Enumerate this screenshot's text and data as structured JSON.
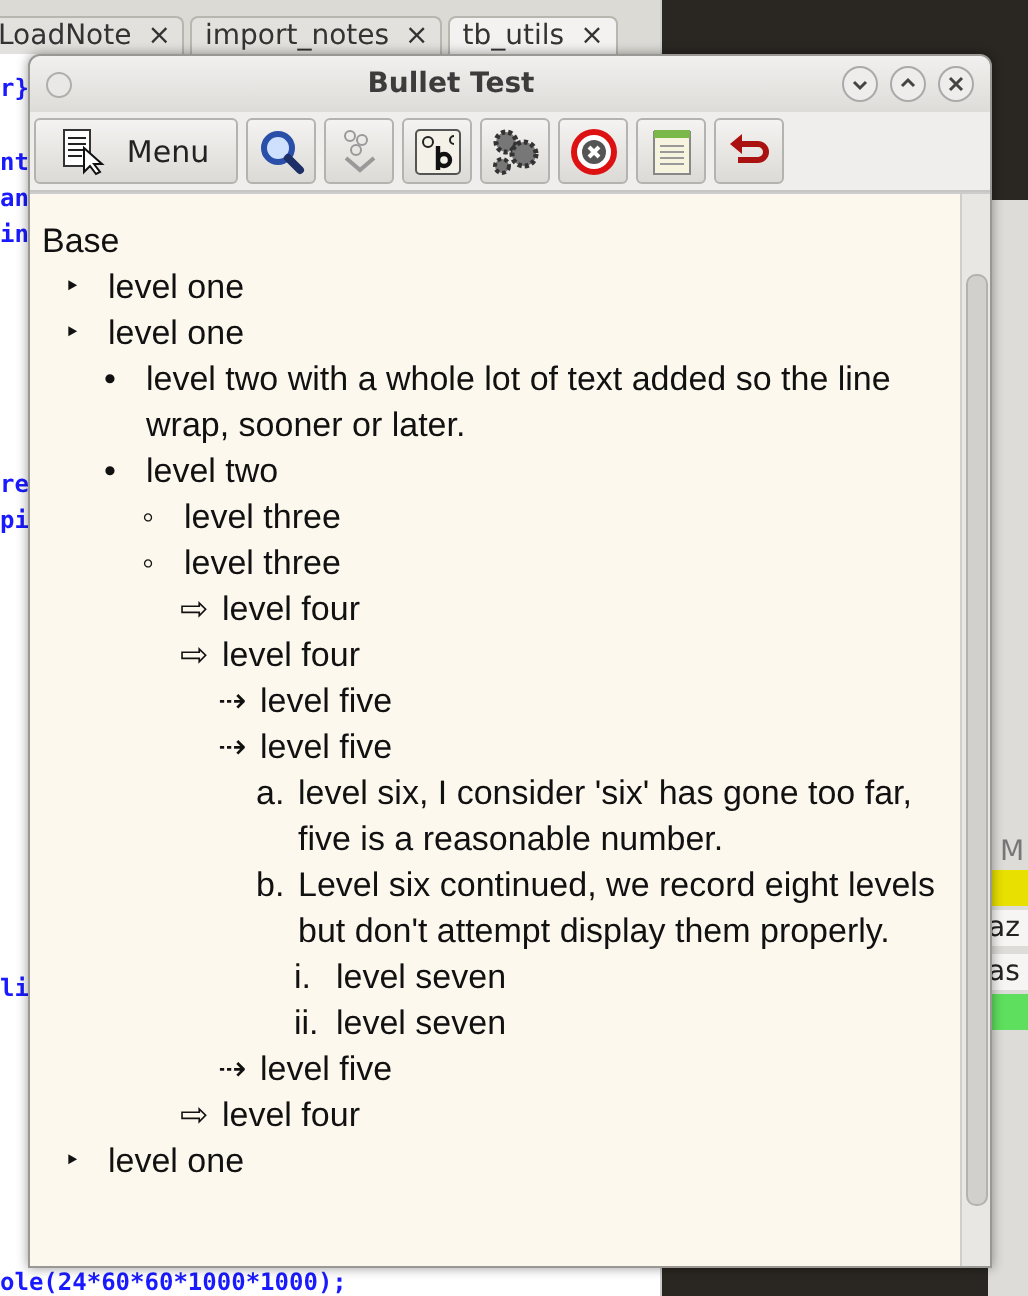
{
  "background": {
    "tabs": [
      {
        "label": "LoadNote",
        "close": "×",
        "selected": false
      },
      {
        "label": "import_notes",
        "close": "×",
        "selected": false
      },
      {
        "label": "tb_utils",
        "close": "×",
        "selected": true
      }
    ],
    "code_lines": [
      "r}",
      "nt",
      "an",
      "in",
      "re",
      "pi",
      "li",
      "ole(24*60*60*1000*1000);"
    ],
    "side_panel": {
      "header": "M",
      "rows": [
        {
          "text": "",
          "color": "#e8e000"
        },
        {
          "text": "az",
          "color": "#f6f5f4"
        },
        {
          "text": "as",
          "color": "#f6f5f4"
        },
        {
          "text": "",
          "color": "#5ee05e"
        }
      ]
    }
  },
  "window": {
    "title": "Bullet Test"
  },
  "toolbar": [
    {
      "kind": "menu",
      "label": "Menu"
    },
    {
      "kind": "search"
    },
    {
      "kind": "bubbles"
    },
    {
      "kind": "abc"
    },
    {
      "kind": "gears"
    },
    {
      "kind": "stop"
    },
    {
      "kind": "note"
    },
    {
      "kind": "undo"
    }
  ],
  "outline": {
    "root": "Base",
    "items": [
      {
        "marker": "‣",
        "text": "level one"
      },
      {
        "marker": "‣",
        "text": "level one",
        "children": [
          {
            "marker": "•",
            "text": "level two with a whole lot of text added so the line wrap, sooner or later."
          },
          {
            "marker": "•",
            "text": "level two",
            "children": [
              {
                "marker": "◦",
                "text": "level three"
              },
              {
                "marker": "◦",
                "text": "level three",
                "children": [
                  {
                    "marker": "⇨",
                    "text": "level four"
                  },
                  {
                    "marker": "⇨",
                    "text": "level four",
                    "children": [
                      {
                        "marker": "⇢",
                        "text": "level five"
                      },
                      {
                        "marker": "⇢",
                        "text": "level five",
                        "children": [
                          {
                            "marker": "a.",
                            "text": "level six, I consider 'six' has gone too far, five is a reasonable number."
                          },
                          {
                            "marker": "b.",
                            "text": "Level six continued, we record eight levels but don't attempt display them properly.",
                            "children": [
                              {
                                "marker": "i.",
                                "text": "level seven"
                              },
                              {
                                "marker": "ii.",
                                "text": "level seven"
                              }
                            ]
                          }
                        ]
                      },
                      {
                        "marker": "⇢",
                        "text": "level five"
                      }
                    ]
                  },
                  {
                    "marker": "⇨",
                    "text": "level four"
                  }
                ]
              }
            ]
          }
        ]
      },
      {
        "marker": "‣",
        "text": "level one"
      }
    ]
  }
}
